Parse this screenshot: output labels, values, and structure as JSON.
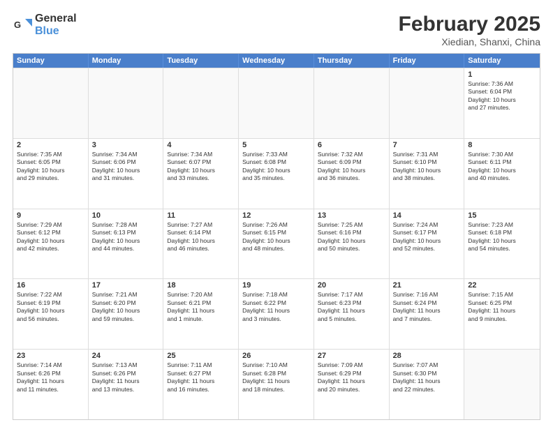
{
  "header": {
    "logo_general": "General",
    "logo_blue": "Blue",
    "title": "February 2025",
    "subtitle": "Xiedian, Shanxi, China"
  },
  "days": [
    "Sunday",
    "Monday",
    "Tuesday",
    "Wednesday",
    "Thursday",
    "Friday",
    "Saturday"
  ],
  "rows": [
    [
      {
        "num": "",
        "text": "",
        "empty": true
      },
      {
        "num": "",
        "text": "",
        "empty": true
      },
      {
        "num": "",
        "text": "",
        "empty": true
      },
      {
        "num": "",
        "text": "",
        "empty": true
      },
      {
        "num": "",
        "text": "",
        "empty": true
      },
      {
        "num": "",
        "text": "",
        "empty": true
      },
      {
        "num": "1",
        "text": "Sunrise: 7:36 AM\nSunset: 6:04 PM\nDaylight: 10 hours\nand 27 minutes.",
        "empty": false
      }
    ],
    [
      {
        "num": "2",
        "text": "Sunrise: 7:35 AM\nSunset: 6:05 PM\nDaylight: 10 hours\nand 29 minutes.",
        "empty": false
      },
      {
        "num": "3",
        "text": "Sunrise: 7:34 AM\nSunset: 6:06 PM\nDaylight: 10 hours\nand 31 minutes.",
        "empty": false
      },
      {
        "num": "4",
        "text": "Sunrise: 7:34 AM\nSunset: 6:07 PM\nDaylight: 10 hours\nand 33 minutes.",
        "empty": false
      },
      {
        "num": "5",
        "text": "Sunrise: 7:33 AM\nSunset: 6:08 PM\nDaylight: 10 hours\nand 35 minutes.",
        "empty": false
      },
      {
        "num": "6",
        "text": "Sunrise: 7:32 AM\nSunset: 6:09 PM\nDaylight: 10 hours\nand 36 minutes.",
        "empty": false
      },
      {
        "num": "7",
        "text": "Sunrise: 7:31 AM\nSunset: 6:10 PM\nDaylight: 10 hours\nand 38 minutes.",
        "empty": false
      },
      {
        "num": "8",
        "text": "Sunrise: 7:30 AM\nSunset: 6:11 PM\nDaylight: 10 hours\nand 40 minutes.",
        "empty": false
      }
    ],
    [
      {
        "num": "9",
        "text": "Sunrise: 7:29 AM\nSunset: 6:12 PM\nDaylight: 10 hours\nand 42 minutes.",
        "empty": false
      },
      {
        "num": "10",
        "text": "Sunrise: 7:28 AM\nSunset: 6:13 PM\nDaylight: 10 hours\nand 44 minutes.",
        "empty": false
      },
      {
        "num": "11",
        "text": "Sunrise: 7:27 AM\nSunset: 6:14 PM\nDaylight: 10 hours\nand 46 minutes.",
        "empty": false
      },
      {
        "num": "12",
        "text": "Sunrise: 7:26 AM\nSunset: 6:15 PM\nDaylight: 10 hours\nand 48 minutes.",
        "empty": false
      },
      {
        "num": "13",
        "text": "Sunrise: 7:25 AM\nSunset: 6:16 PM\nDaylight: 10 hours\nand 50 minutes.",
        "empty": false
      },
      {
        "num": "14",
        "text": "Sunrise: 7:24 AM\nSunset: 6:17 PM\nDaylight: 10 hours\nand 52 minutes.",
        "empty": false
      },
      {
        "num": "15",
        "text": "Sunrise: 7:23 AM\nSunset: 6:18 PM\nDaylight: 10 hours\nand 54 minutes.",
        "empty": false
      }
    ],
    [
      {
        "num": "16",
        "text": "Sunrise: 7:22 AM\nSunset: 6:19 PM\nDaylight: 10 hours\nand 56 minutes.",
        "empty": false
      },
      {
        "num": "17",
        "text": "Sunrise: 7:21 AM\nSunset: 6:20 PM\nDaylight: 10 hours\nand 59 minutes.",
        "empty": false
      },
      {
        "num": "18",
        "text": "Sunrise: 7:20 AM\nSunset: 6:21 PM\nDaylight: 11 hours\nand 1 minute.",
        "empty": false
      },
      {
        "num": "19",
        "text": "Sunrise: 7:18 AM\nSunset: 6:22 PM\nDaylight: 11 hours\nand 3 minutes.",
        "empty": false
      },
      {
        "num": "20",
        "text": "Sunrise: 7:17 AM\nSunset: 6:23 PM\nDaylight: 11 hours\nand 5 minutes.",
        "empty": false
      },
      {
        "num": "21",
        "text": "Sunrise: 7:16 AM\nSunset: 6:24 PM\nDaylight: 11 hours\nand 7 minutes.",
        "empty": false
      },
      {
        "num": "22",
        "text": "Sunrise: 7:15 AM\nSunset: 6:25 PM\nDaylight: 11 hours\nand 9 minutes.",
        "empty": false
      }
    ],
    [
      {
        "num": "23",
        "text": "Sunrise: 7:14 AM\nSunset: 6:26 PM\nDaylight: 11 hours\nand 11 minutes.",
        "empty": false
      },
      {
        "num": "24",
        "text": "Sunrise: 7:13 AM\nSunset: 6:26 PM\nDaylight: 11 hours\nand 13 minutes.",
        "empty": false
      },
      {
        "num": "25",
        "text": "Sunrise: 7:11 AM\nSunset: 6:27 PM\nDaylight: 11 hours\nand 16 minutes.",
        "empty": false
      },
      {
        "num": "26",
        "text": "Sunrise: 7:10 AM\nSunset: 6:28 PM\nDaylight: 11 hours\nand 18 minutes.",
        "empty": false
      },
      {
        "num": "27",
        "text": "Sunrise: 7:09 AM\nSunset: 6:29 PM\nDaylight: 11 hours\nand 20 minutes.",
        "empty": false
      },
      {
        "num": "28",
        "text": "Sunrise: 7:07 AM\nSunset: 6:30 PM\nDaylight: 11 hours\nand 22 minutes.",
        "empty": false
      },
      {
        "num": "",
        "text": "",
        "empty": true
      }
    ]
  ]
}
